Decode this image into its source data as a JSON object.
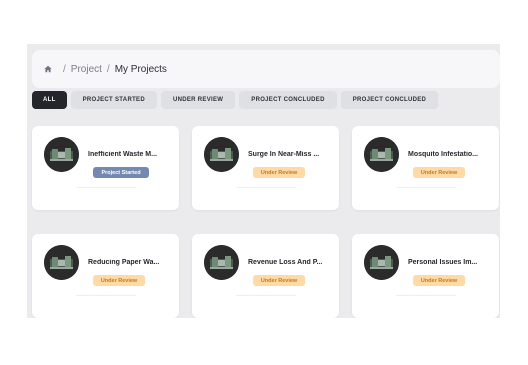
{
  "breadcrumb": {
    "home_icon": "home-icon",
    "separator": "/",
    "project": "Project",
    "current": "My Projects"
  },
  "filters": [
    {
      "label": "ALL",
      "active": true
    },
    {
      "label": "PROJECT STARTED",
      "active": false
    },
    {
      "label": "UNDER REVIEW",
      "active": false
    },
    {
      "label": "PROJECT CONCLUDED",
      "active": false
    },
    {
      "label": "PROJECT CONCLUDED",
      "active": false
    }
  ],
  "cards": [
    {
      "title": "Inefficient Waste M...",
      "status": "Project Started",
      "status_type": "started"
    },
    {
      "title": "Surge In Near-Miss ...",
      "status": "Under Review",
      "status_type": "review"
    },
    {
      "title": "Mosquito Infestatio...",
      "status": "Under Review",
      "status_type": "review"
    },
    {
      "title": "Reducing Paper Wa...",
      "status": "Under Review",
      "status_type": "review"
    },
    {
      "title": "Revenue Loss And P...",
      "status": "Under Review",
      "status_type": "review"
    },
    {
      "title": "Personal Issues Im...",
      "status": "Under Review",
      "status_type": "review"
    }
  ],
  "colors": {
    "background": "#ebebee",
    "active_filter": "#25262b",
    "badge_review_bg": "#ffd9a6",
    "badge_review_text": "#c97a16",
    "badge_started_bg": "#7489b2"
  }
}
